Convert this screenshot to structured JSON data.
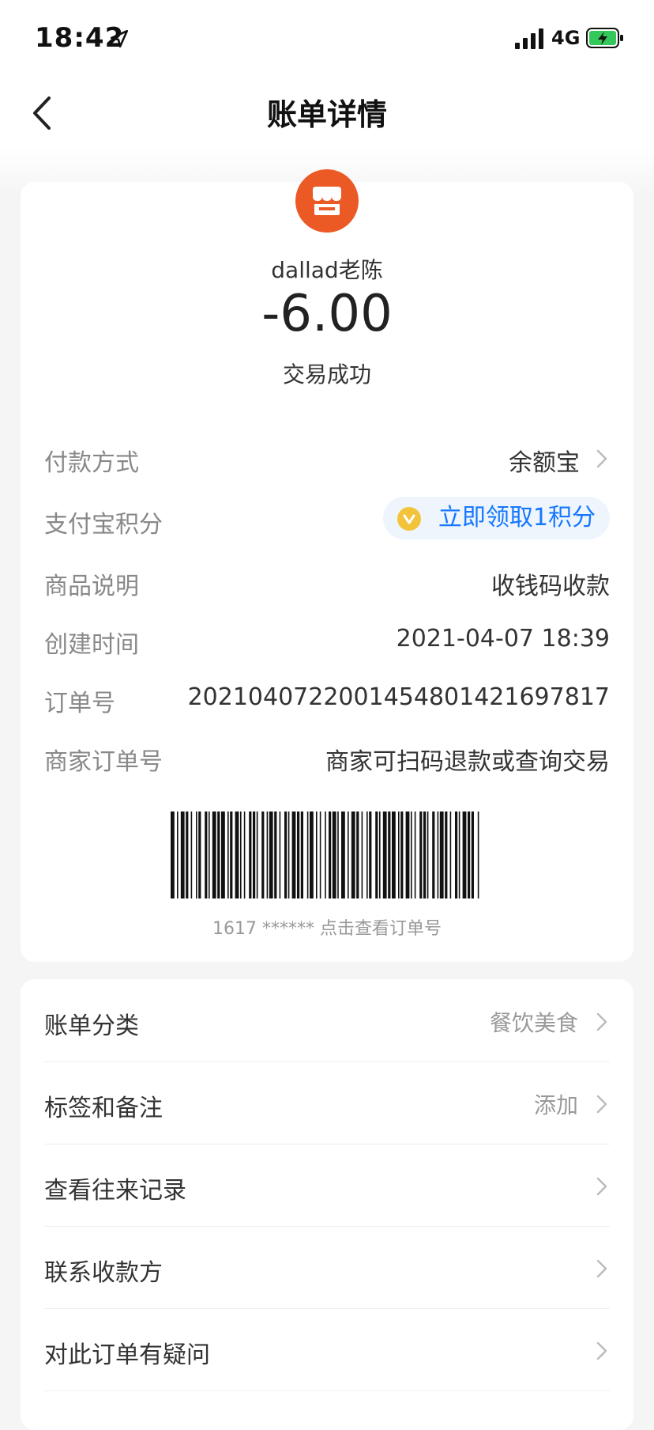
{
  "status_bar": {
    "time": "18:42",
    "network": "4G"
  },
  "nav": {
    "title": "账单详情"
  },
  "transaction": {
    "merchant": "dallad老陈",
    "amount": "-6.00",
    "status": "交易成功"
  },
  "details": [
    {
      "label": "付款方式",
      "value": "余额宝"
    },
    {
      "label": "支付宝积分",
      "value": "立即领取1积分"
    },
    {
      "label": "商品说明",
      "value": "收钱码收款"
    },
    {
      "label": "创建时间",
      "value": "2021-04-07 18:39"
    },
    {
      "label": "订单号",
      "value": "2021040722001454801421697817"
    },
    {
      "label": "商家订单号",
      "value": "商家可扫码退款或查询交易"
    }
  ],
  "barcode": {
    "caption": "1617 ****** 点击查看订单号"
  },
  "menu": [
    {
      "label": "账单分类",
      "value": "餐饮美食"
    },
    {
      "label": "标签和备注",
      "value": "添加"
    },
    {
      "label": "查看往来记录",
      "value": ""
    },
    {
      "label": "联系收款方",
      "value": ""
    },
    {
      "label": "对此订单有疑问",
      "value": ""
    }
  ],
  "colors": {
    "merchant_icon": "#eb5a24",
    "link_blue": "#1677ff",
    "battery_green": "#34c759"
  },
  "icons": [
    "location-arrow-icon",
    "signal-icon",
    "battery-charging-icon",
    "back-arrow-icon",
    "store-icon",
    "chevron-right-icon",
    "coin-icon"
  ]
}
